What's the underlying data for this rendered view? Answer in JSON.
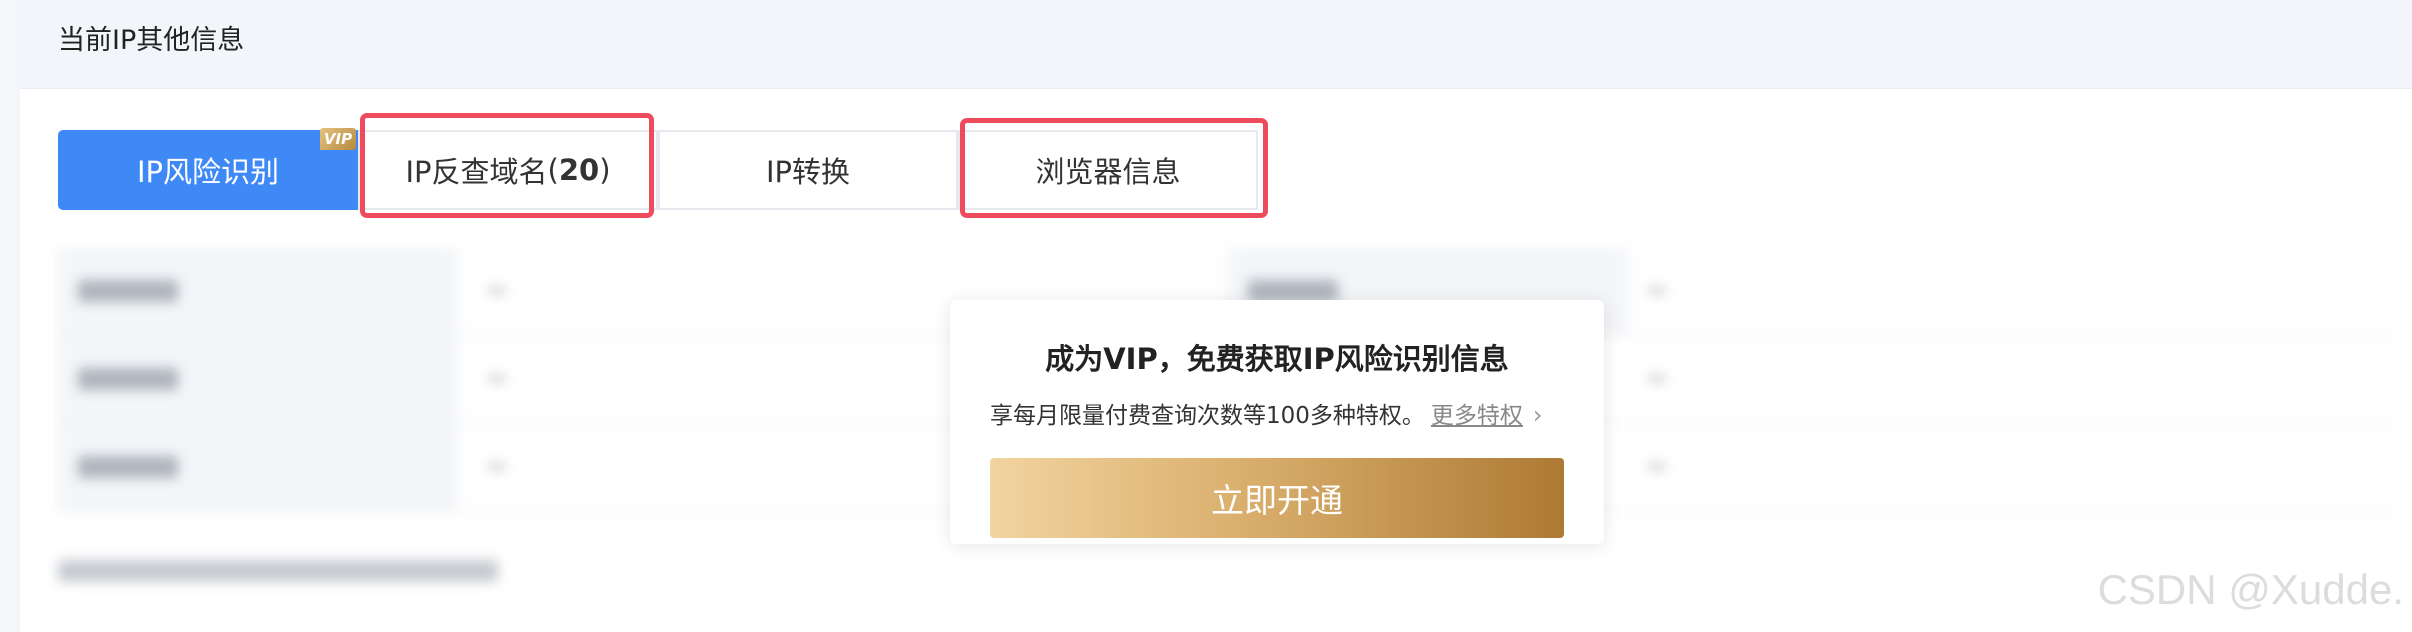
{
  "section": {
    "title": "当前IP其他信息"
  },
  "tabs": [
    {
      "label": "IP风险识别",
      "active": true,
      "badge": "VIP"
    },
    {
      "label": "IP反查域名",
      "count": "20"
    },
    {
      "label": "IP转换"
    },
    {
      "label": "浏览器信息"
    }
  ],
  "popup": {
    "title": "成为VIP，免费获取IP风险识别信息",
    "desc": "享每月限量付费查询次数等100多种特权。",
    "link": "更多特权",
    "button": "立即开通"
  },
  "watermark": "CSDN @Xudde.",
  "colors": {
    "accent": "#3f89f7",
    "highlight_box": "#ee4c5d",
    "vip_gold_start": "#f2d4a0",
    "vip_gold_end": "#ad7a34"
  },
  "icons": [
    "chevron-right-icon"
  ]
}
